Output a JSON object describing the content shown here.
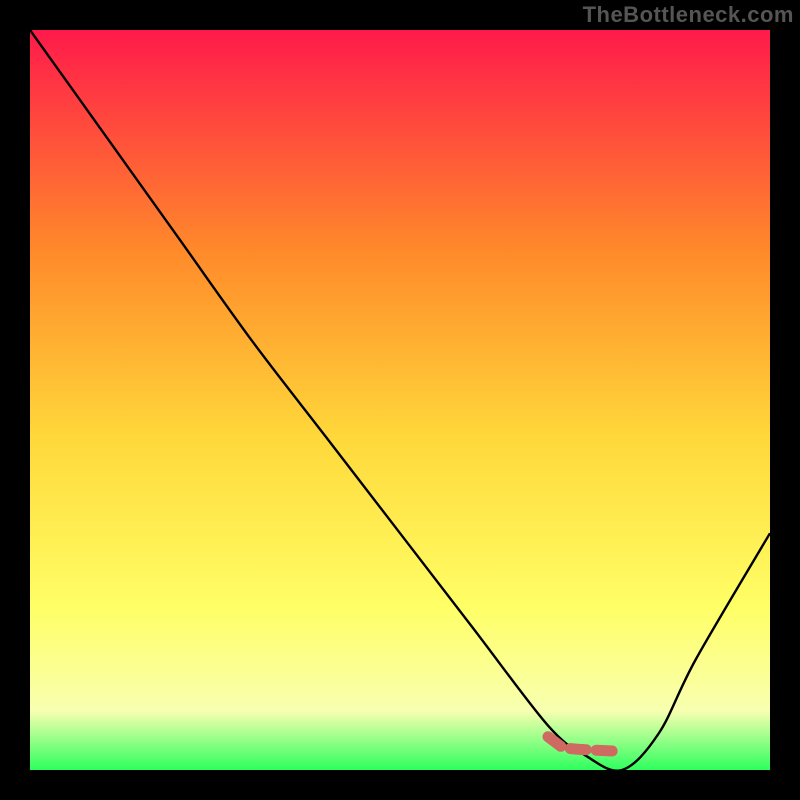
{
  "watermark": "TheBottleneck.com",
  "colors": {
    "gradient_top": "#ff1a4b",
    "gradient_mid_upper": "#ff8a2a",
    "gradient_mid": "#ffd83a",
    "gradient_mid_lower": "#ffff66",
    "gradient_lower": "#f8ffb0",
    "gradient_bottom": "#2eff5e",
    "curve": "#000000",
    "marker": "#cf6a63"
  },
  "chart_data": {
    "type": "line",
    "title": "",
    "xlabel": "",
    "ylabel": "",
    "x": [
      0.0,
      0.1,
      0.2,
      0.3,
      0.4,
      0.5,
      0.6,
      0.7,
      0.75,
      0.8,
      0.85,
      0.9,
      1.0
    ],
    "values": [
      1.0,
      0.86,
      0.72,
      0.58,
      0.45,
      0.32,
      0.19,
      0.06,
      0.02,
      0.0,
      0.05,
      0.15,
      0.32
    ],
    "ylim": [
      0,
      1
    ],
    "xlim": [
      0,
      1
    ],
    "highlight_segment": {
      "x": [
        0.7,
        0.72,
        0.74,
        0.76,
        0.78,
        0.8
      ],
      "y": [
        0.045,
        0.03,
        0.028,
        0.027,
        0.026,
        0.025
      ]
    }
  }
}
